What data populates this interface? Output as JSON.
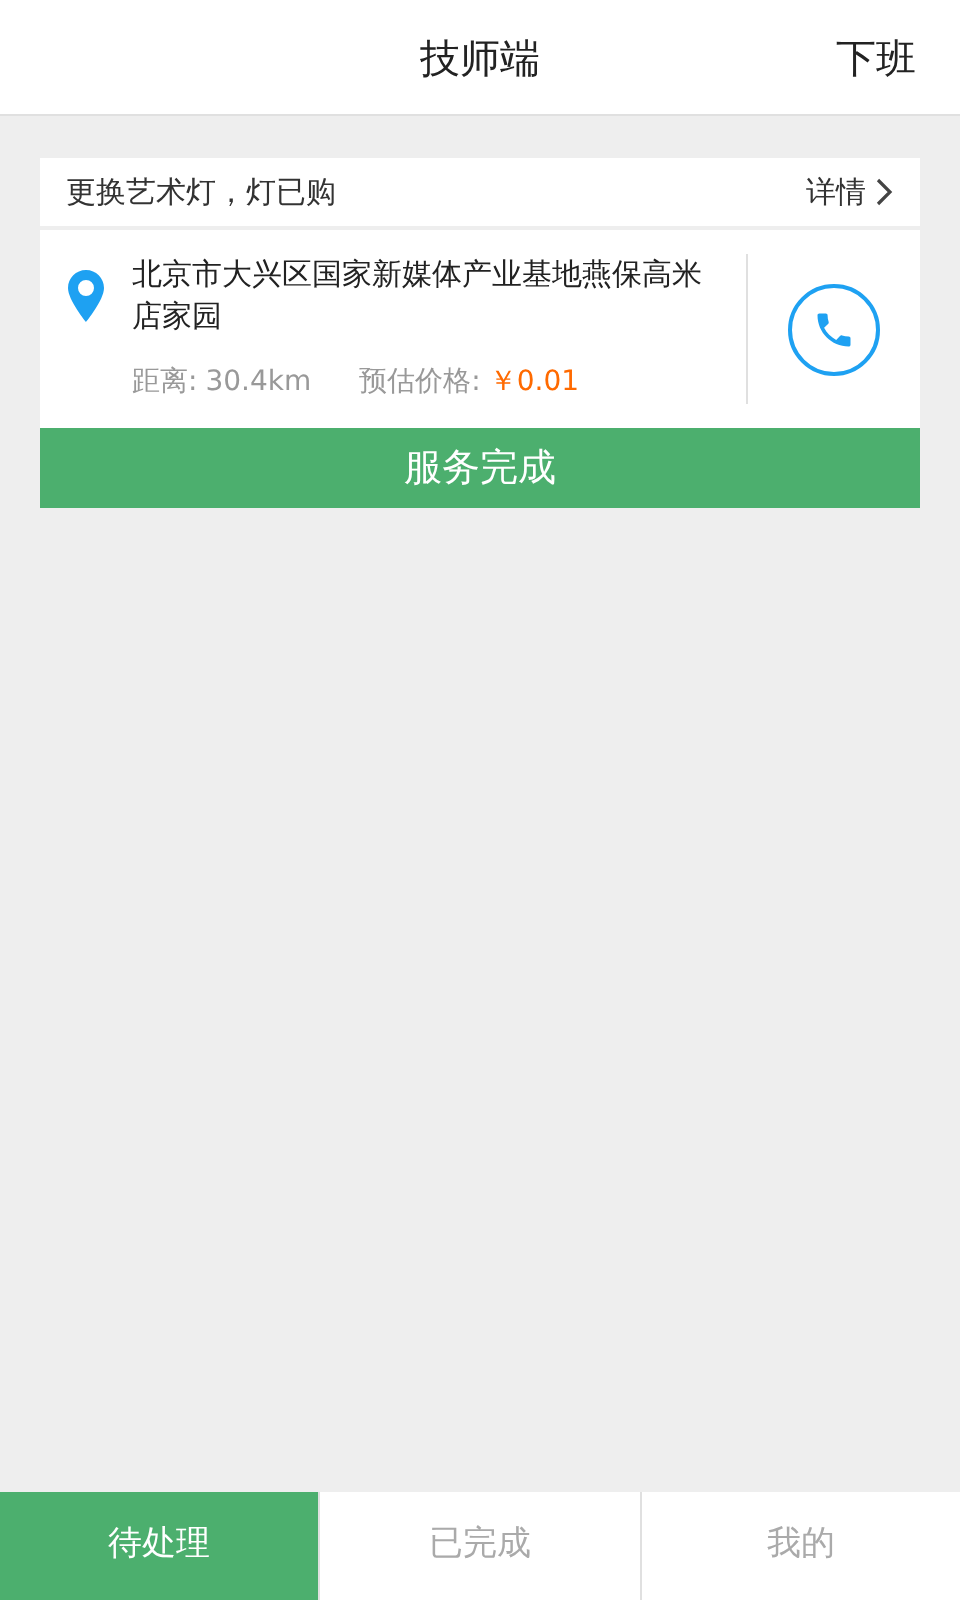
{
  "header": {
    "title": "技师端",
    "action": "下班"
  },
  "orders": [
    {
      "title": "更换艺术灯，灯已购",
      "details": "详情",
      "address": "北京市大兴区国家新媒体产业基地燕保高米店家园",
      "distance_label": "距离:",
      "distance": "30.4km",
      "price_label": "预估价格:",
      "price": "￥0.01",
      "button": "服务完成"
    }
  ],
  "tabs": [
    {
      "label": "待处理",
      "selected": true
    },
    {
      "label": "已完成",
      "selected": false
    },
    {
      "label": "我的",
      "selected": false
    }
  ]
}
